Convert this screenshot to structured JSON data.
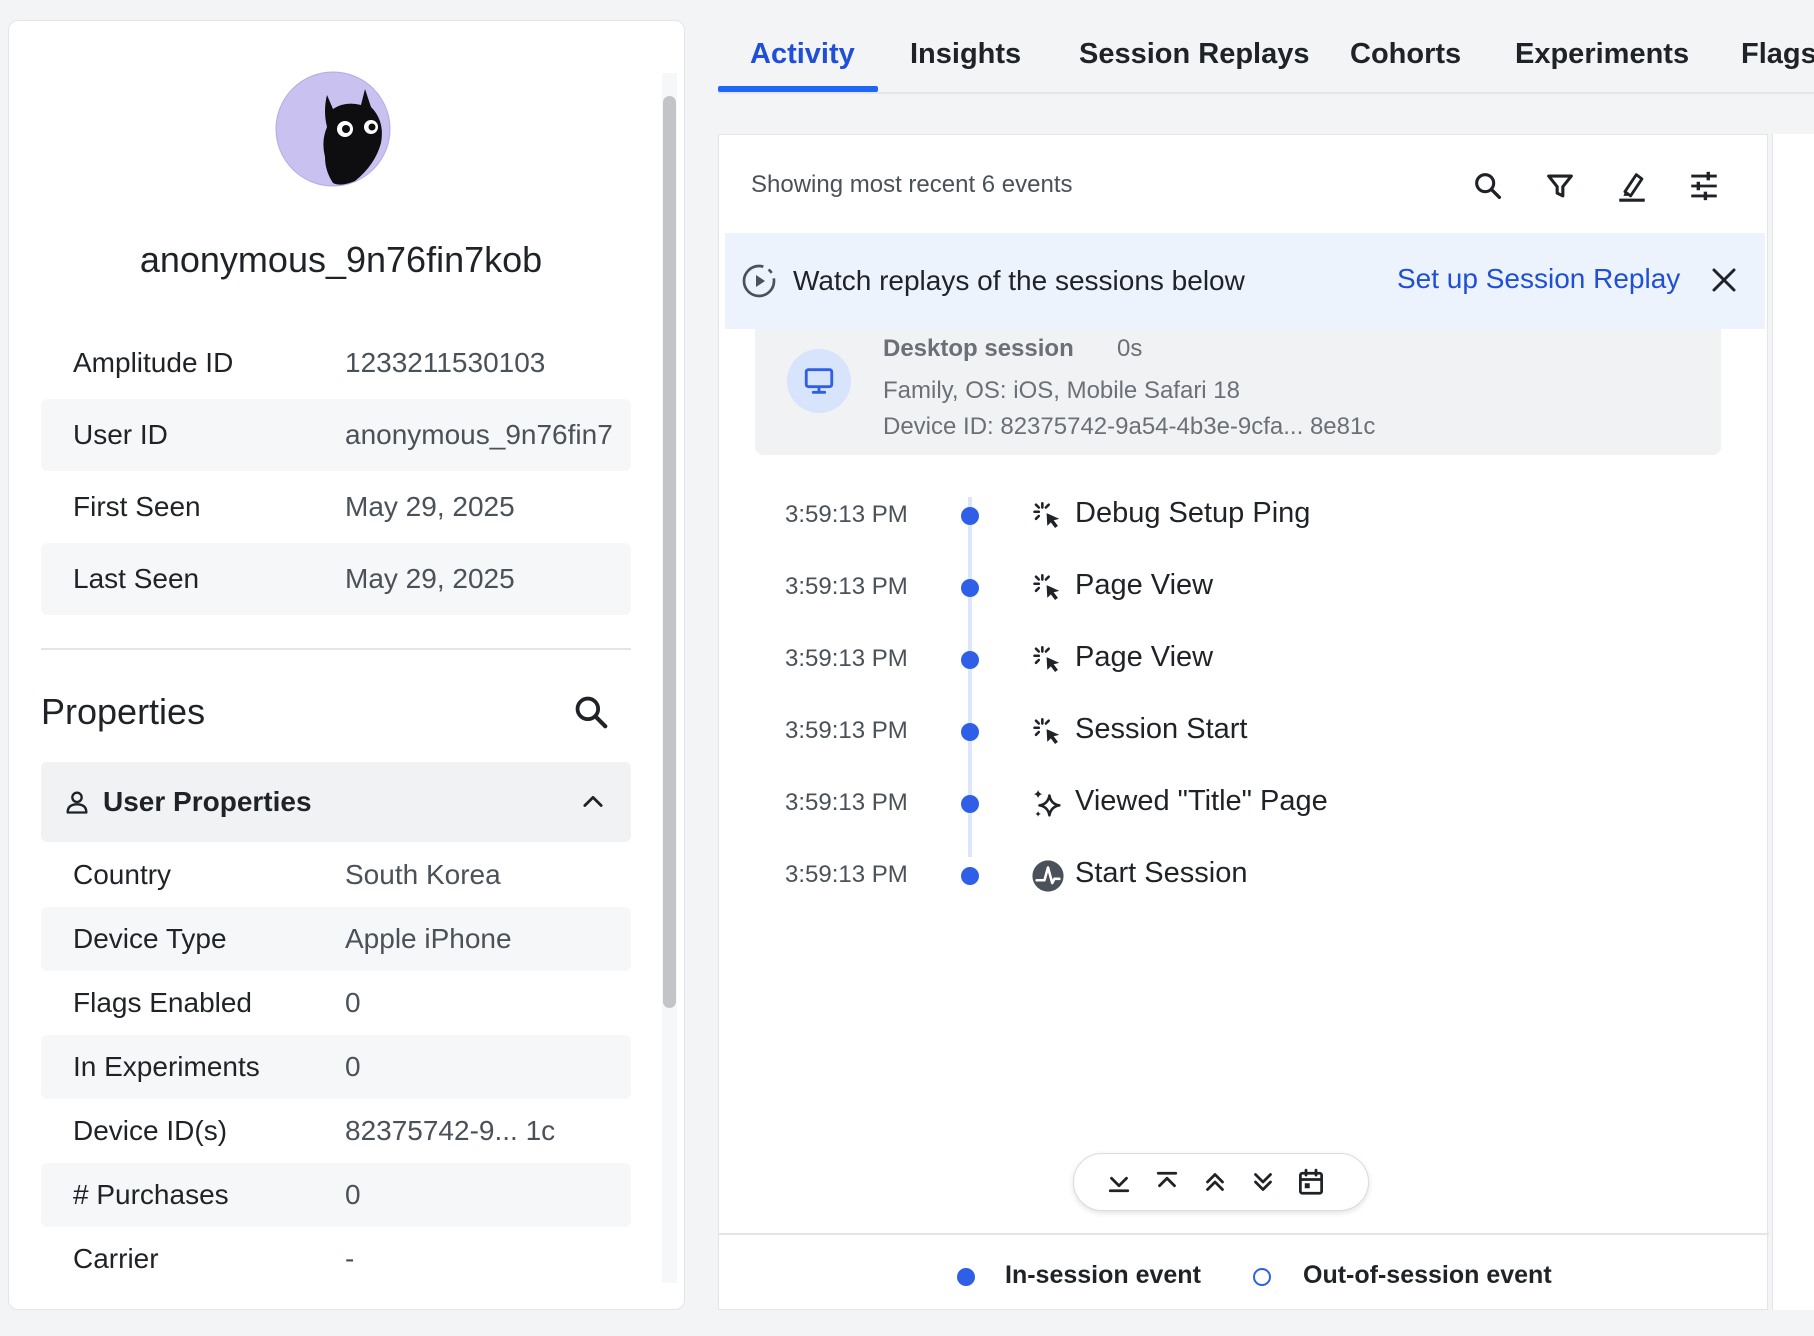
{
  "profile": {
    "name": "anonymous_9n76fin7kob",
    "info": [
      {
        "key": "Amplitude ID",
        "value": "1233211530103"
      },
      {
        "key": "User ID",
        "value": "anonymous_9n76fin7"
      },
      {
        "key": "First Seen",
        "value": "May 29, 2025"
      },
      {
        "key": "Last Seen",
        "value": "May 29, 2025"
      }
    ]
  },
  "properties": {
    "title": "Properties",
    "group_label": "User Properties",
    "rows": [
      {
        "key": "Country",
        "value": "South Korea"
      },
      {
        "key": "Device Type",
        "value": "Apple iPhone"
      },
      {
        "key": "Flags Enabled",
        "value": "0"
      },
      {
        "key": "In Experiments",
        "value": "0"
      },
      {
        "key": "Device ID(s)",
        "value": "82375742-9... 1c"
      },
      {
        "key": "# Purchases",
        "value": "0"
      },
      {
        "key": "Carrier",
        "value": "-"
      }
    ]
  },
  "tabs": [
    {
      "label": "Activity",
      "active": true
    },
    {
      "label": "Insights"
    },
    {
      "label": "Session Replays"
    },
    {
      "label": "Cohorts"
    },
    {
      "label": "Experiments"
    },
    {
      "label": "Flags"
    }
  ],
  "activity": {
    "showing": "Showing most recent 6 events",
    "toolbar_icons": [
      "search-icon",
      "filter-icon",
      "highlighter-icon",
      "sliders-icon"
    ],
    "banner": {
      "text": "Watch replays of the sessions below",
      "link": "Set up Session Replay"
    },
    "session": {
      "title": "Desktop session",
      "duration": "0s",
      "os": "Family, OS: iOS, Mobile Safari 18",
      "device": "Device ID: 82375742-9a54-4b3e-9cfa... 8e81c"
    },
    "events": [
      {
        "time": "3:59:13 PM",
        "name": "Debug Setup Ping",
        "icon": "sparkle-cursor-icon"
      },
      {
        "time": "3:59:13 PM",
        "name": "Page View",
        "icon": "sparkle-cursor-icon"
      },
      {
        "time": "3:59:13 PM",
        "name": "Page View",
        "icon": "sparkle-cursor-icon"
      },
      {
        "time": "3:59:13 PM",
        "name": "Session Start",
        "icon": "sparkle-cursor-icon"
      },
      {
        "time": "3:59:13 PM",
        "name": "Viewed \"Title\" Page",
        "icon": "sparkles-icon"
      },
      {
        "time": "3:59:13 PM",
        "name": "Start Session",
        "icon": "amplitude-logo-icon"
      }
    ],
    "nav_icons": [
      "scroll-to-bottom-icon",
      "scroll-to-top-icon",
      "previous-session-icon",
      "next-session-icon",
      "calendar-icon"
    ]
  },
  "legend": {
    "in_session": "In-session event",
    "out_session": "Out-of-session event"
  },
  "colors": {
    "accent": "#1e66f5",
    "link": "#1e4fd6",
    "banner_bg": "#edf3fd",
    "avatar_bg": "#c9c1f0"
  }
}
